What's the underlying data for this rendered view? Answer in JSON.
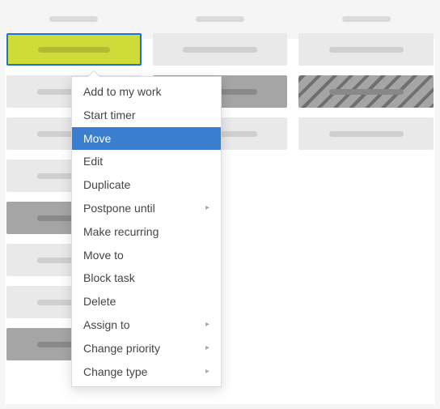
{
  "menu": {
    "items": [
      {
        "label": "Add to my work",
        "submenu": false,
        "selected": false
      },
      {
        "label": "Start timer",
        "submenu": false,
        "selected": false
      },
      {
        "label": "Move",
        "submenu": false,
        "selected": true
      },
      {
        "label": "Edit",
        "submenu": false,
        "selected": false
      },
      {
        "label": "Duplicate",
        "submenu": false,
        "selected": false
      },
      {
        "label": "Postpone until",
        "submenu": true,
        "selected": false
      },
      {
        "label": "Make recurring",
        "submenu": false,
        "selected": false
      },
      {
        "label": "Move to",
        "submenu": false,
        "selected": false
      },
      {
        "label": "Block task",
        "submenu": false,
        "selected": false
      },
      {
        "label": "Delete",
        "submenu": false,
        "selected": false
      },
      {
        "label": "Assign to",
        "submenu": true,
        "selected": false
      },
      {
        "label": "Change priority",
        "submenu": true,
        "selected": false
      },
      {
        "label": "Change type",
        "submenu": true,
        "selected": false
      }
    ]
  },
  "columns": [
    {
      "cards": [
        {
          "variant": "selected"
        },
        {
          "variant": "normal"
        },
        {
          "variant": "normal"
        },
        {
          "variant": "normal"
        },
        {
          "variant": "dark"
        },
        {
          "variant": "normal"
        },
        {
          "variant": "normal"
        },
        {
          "variant": "dark"
        }
      ]
    },
    {
      "cards": [
        {
          "variant": "normal"
        },
        {
          "variant": "dark"
        },
        {
          "variant": "normal"
        }
      ]
    },
    {
      "cards": [
        {
          "variant": "normal"
        },
        {
          "variant": "hatched"
        },
        {
          "variant": "normal"
        }
      ]
    }
  ]
}
